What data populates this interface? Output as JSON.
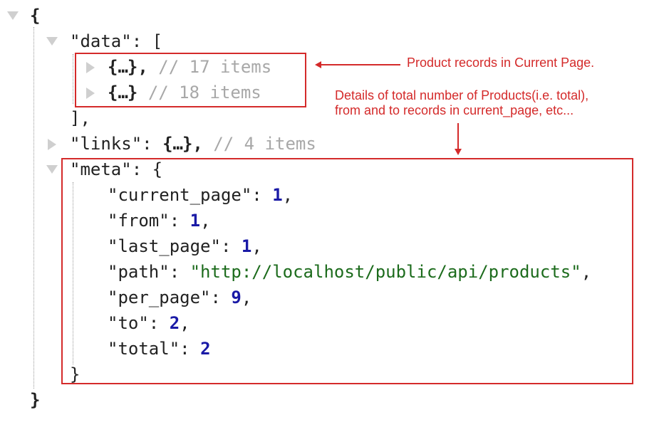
{
  "root": {
    "open_brace": "{",
    "close_brace": "}"
  },
  "data_node": {
    "key": "\"data\"",
    "colon_open": ": [",
    "close": "],",
    "items": [
      {
        "open": "{",
        "ellipsis": "…",
        "close": "},",
        "comment": "// 17 items"
      },
      {
        "open": "{",
        "ellipsis": "…",
        "close": "}",
        "comment": "// 18 items"
      }
    ]
  },
  "links_node": {
    "key": "\"links\"",
    "colon": ": ",
    "open": "{",
    "ellipsis": "…",
    "close": "},",
    "comment": "// 4 items"
  },
  "meta_node": {
    "key": "\"meta\"",
    "colon_open": ": {",
    "close": "}",
    "fields": [
      {
        "key": "\"current_page\"",
        "sep": ": ",
        "value": "1",
        "trail": ","
      },
      {
        "key": "\"from\"",
        "sep": ": ",
        "value": "1",
        "trail": ","
      },
      {
        "key": "\"last_page\"",
        "sep": ": ",
        "value": "1",
        "trail": ","
      },
      {
        "key": "\"path\"",
        "sep": ": ",
        "value": "\"http://localhost/public/api/products\"",
        "trail": ","
      },
      {
        "key": "\"per_page\"",
        "sep": ": ",
        "value": "9",
        "trail": ","
      },
      {
        "key": "\"to\"",
        "sep": ": ",
        "value": "2",
        "trail": ","
      },
      {
        "key": "\"total\"",
        "sep": ": ",
        "value": "2",
        "trail": ""
      }
    ]
  },
  "annotations": {
    "data_note": "Product records in Current Page.",
    "meta_note_line1": "Details of total number of Products(i.e. total),",
    "meta_note_line2": "from and to records in current_page, etc..."
  },
  "colors": {
    "annotation_red": "#d42a2a",
    "number_blue": "#1a1aa6",
    "string_green": "#1c6b1c",
    "comment_gray": "#a8a8a8",
    "toggle_gray": "#cfcfcf"
  }
}
